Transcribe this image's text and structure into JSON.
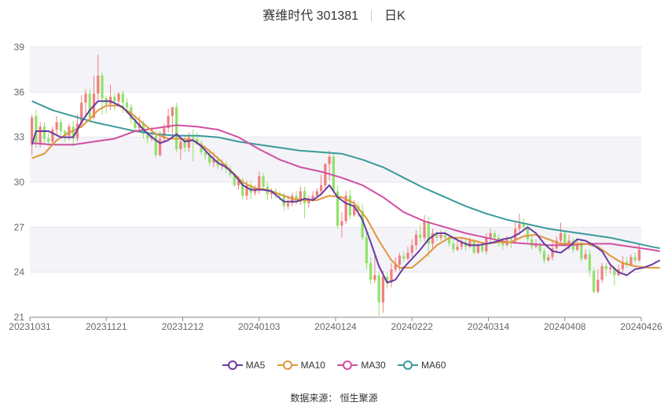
{
  "header": {
    "stock_name": "赛维时代 301381",
    "period": "日K"
  },
  "source_text": "数据来源：  恒生聚源",
  "colors": {
    "up": "#f08080",
    "down": "#91e26a",
    "grid": "#e6e6ee",
    "band": "#f3f3f8"
  },
  "chart_data": {
    "type": "candlestick",
    "title": "赛维时代 301381",
    "ylim": [
      21,
      39
    ],
    "y_ticks": [
      21,
      24,
      27,
      30,
      33,
      36,
      39
    ],
    "x_ticks": [
      "20231031",
      "20231121",
      "20231212",
      "20240103",
      "20240124",
      "20240222",
      "20240314",
      "20240408",
      "20240426"
    ],
    "legend": [
      {
        "name": "MA5",
        "color": "#6a3aa0"
      },
      {
        "name": "MA10",
        "color": "#e0953a"
      },
      {
        "name": "MA30",
        "color": "#d050a0"
      },
      {
        "name": "MA60",
        "color": "#3a9a9a"
      }
    ],
    "candles": [
      [
        32.6,
        34.3,
        31.8,
        34.5
      ],
      [
        34.4,
        32.6,
        32.3,
        34.8
      ],
      [
        32.5,
        33.7,
        32.3,
        34.0
      ],
      [
        33.7,
        32.9,
        32.6,
        34.0
      ],
      [
        32.9,
        32.7,
        32.4,
        33.3
      ],
      [
        32.7,
        33.5,
        32.5,
        33.7
      ],
      [
        33.5,
        34.0,
        33.2,
        34.4
      ],
      [
        34.0,
        33.4,
        33.1,
        34.2
      ],
      [
        33.4,
        33.1,
        32.7,
        33.5
      ],
      [
        33.1,
        33.7,
        32.8,
        33.9
      ],
      [
        33.7,
        32.9,
        32.4,
        34.1
      ],
      [
        32.9,
        33.9,
        32.7,
        34.5
      ],
      [
        33.9,
        35.3,
        33.6,
        35.8
      ],
      [
        35.3,
        35.9,
        34.4,
        36.2
      ],
      [
        35.9,
        34.3,
        34.0,
        36.2
      ],
      [
        34.3,
        35.9,
        34.2,
        37.1
      ],
      [
        35.9,
        37.1,
        35.5,
        38.5
      ],
      [
        37.1,
        35.6,
        34.5,
        37.3
      ],
      [
        35.6,
        35.2,
        34.6,
        35.8
      ],
      [
        35.2,
        35.7,
        34.8,
        36.5
      ],
      [
        35.7,
        35.4,
        34.8,
        35.9
      ],
      [
        35.4,
        35.9,
        35.1,
        36.0
      ],
      [
        35.9,
        35.3,
        34.6,
        36.1
      ],
      [
        35.3,
        35.0,
        34.6,
        35.6
      ],
      [
        35.0,
        34.2,
        33.9,
        35.2
      ],
      [
        34.2,
        33.6,
        33.4,
        34.5
      ],
      [
        33.6,
        33.9,
        33.4,
        34.4
      ],
      [
        33.9,
        33.2,
        32.9,
        34.1
      ],
      [
        33.2,
        32.9,
        32.6,
        33.4
      ],
      [
        32.9,
        33.1,
        32.7,
        33.7
      ],
      [
        33.1,
        31.8,
        31.6,
        33.4
      ],
      [
        31.8,
        32.9,
        31.7,
        33.4
      ],
      [
        32.9,
        33.6,
        32.6,
        33.9
      ],
      [
        33.6,
        34.4,
        33.3,
        34.9
      ],
      [
        34.4,
        35.0,
        33.1,
        35.0
      ],
      [
        35.0,
        32.2,
        32.0,
        35.3
      ],
      [
        32.2,
        32.7,
        31.5,
        32.9
      ],
      [
        32.7,
        32.3,
        32.0,
        33.1
      ],
      [
        32.3,
        33.0,
        32.0,
        33.3
      ],
      [
        33.0,
        32.9,
        31.4,
        33.5
      ],
      [
        32.9,
        32.6,
        32.5,
        33.3
      ],
      [
        32.6,
        32.0,
        31.8,
        32.8
      ],
      [
        32.0,
        31.8,
        31.5,
        32.4
      ],
      [
        31.8,
        31.3,
        31.1,
        32.2
      ],
      [
        31.3,
        31.5,
        31.0,
        32.0
      ],
      [
        31.5,
        31.1,
        30.9,
        31.7
      ],
      [
        31.1,
        31.2,
        30.8,
        31.5
      ],
      [
        31.2,
        30.9,
        30.6,
        31.4
      ],
      [
        30.9,
        30.5,
        30.3,
        31.1
      ],
      [
        30.5,
        29.8,
        29.7,
        30.6
      ],
      [
        29.8,
        30.1,
        29.5,
        30.4
      ],
      [
        30.1,
        29.1,
        28.9,
        30.3
      ],
      [
        29.1,
        29.8,
        28.8,
        30.1
      ],
      [
        29.8,
        29.3,
        28.9,
        30.1
      ],
      [
        29.3,
        29.5,
        29.1,
        29.8
      ],
      [
        29.5,
        30.4,
        29.2,
        30.7
      ],
      [
        30.4,
        29.7,
        29.4,
        30.6
      ],
      [
        29.7,
        29.2,
        28.8,
        30.0
      ],
      [
        29.2,
        29.4,
        28.9,
        29.6
      ],
      [
        29.4,
        29.2,
        28.9,
        29.6
      ],
      [
        29.2,
        29.1,
        28.8,
        29.4
      ],
      [
        29.1,
        28.4,
        28.1,
        29.3
      ],
      [
        28.4,
        28.6,
        28.2,
        29.1
      ],
      [
        28.6,
        29.1,
        28.4,
        29.3
      ],
      [
        29.1,
        28.7,
        28.5,
        29.4
      ],
      [
        28.7,
        29.4,
        28.5,
        29.7
      ],
      [
        29.4,
        28.6,
        27.6,
        29.7
      ],
      [
        28.6,
        28.8,
        28.3,
        29.1
      ],
      [
        28.8,
        29.1,
        28.7,
        29.4
      ],
      [
        29.1,
        29.4,
        29.0,
        29.6
      ],
      [
        29.4,
        29.8,
        29.1,
        30.5
      ],
      [
        29.8,
        31.2,
        29.6,
        31.3
      ],
      [
        31.2,
        31.7,
        30.1,
        32.1
      ],
      [
        31.7,
        29.4,
        29.3,
        31.9
      ],
      [
        29.4,
        27.1,
        26.9,
        29.8
      ],
      [
        27.1,
        27.4,
        26.3,
        28.0
      ],
      [
        27.4,
        29.1,
        27.2,
        29.4
      ],
      [
        29.1,
        27.8,
        27.5,
        29.5
      ],
      [
        27.8,
        28.4,
        27.7,
        28.8
      ],
      [
        28.4,
        28.1,
        27.7,
        28.7
      ],
      [
        28.1,
        26.3,
        26.1,
        28.5
      ],
      [
        26.3,
        24.6,
        24.2,
        26.7
      ],
      [
        24.6,
        23.5,
        23.2,
        25.0
      ],
      [
        23.5,
        23.8,
        23.3,
        25.1
      ],
      [
        23.8,
        22.0,
        21.1,
        24.0
      ],
      [
        22.0,
        23.7,
        21.3,
        24.1
      ],
      [
        23.7,
        23.3,
        22.9,
        24.0
      ],
      [
        23.3,
        24.2,
        23.0,
        24.6
      ],
      [
        24.2,
        24.5,
        24.0,
        25.0
      ],
      [
        24.5,
        25.1,
        24.1,
        25.3
      ],
      [
        25.1,
        24.9,
        24.7,
        25.4
      ],
      [
        24.9,
        25.3,
        24.8,
        25.7
      ],
      [
        25.3,
        25.8,
        25.0,
        26.2
      ],
      [
        25.8,
        26.5,
        25.5,
        26.8
      ],
      [
        26.5,
        26.3,
        26.0,
        27.2
      ],
      [
        26.3,
        27.4,
        26.1,
        27.8
      ],
      [
        27.4,
        25.9,
        25.0,
        27.7
      ],
      [
        25.9,
        26.6,
        25.6,
        26.9
      ],
      [
        26.6,
        26.3,
        26.1,
        26.7
      ],
      [
        26.3,
        26.5,
        26.1,
        26.8
      ],
      [
        26.5,
        26.3,
        26.0,
        26.8
      ],
      [
        26.3,
        25.9,
        25.7,
        26.5
      ],
      [
        25.9,
        25.5,
        25.3,
        26.2
      ],
      [
        25.5,
        25.7,
        25.4,
        26.1
      ],
      [
        25.7,
        26.0,
        25.5,
        26.3
      ],
      [
        26.0,
        25.7,
        25.4,
        26.2
      ],
      [
        25.7,
        26.1,
        25.6,
        26.3
      ],
      [
        26.1,
        25.3,
        25.2,
        26.2
      ],
      [
        25.3,
        25.8,
        25.2,
        26.1
      ],
      [
        25.8,
        25.4,
        25.3,
        26.0
      ],
      [
        25.4,
        26.3,
        25.2,
        26.6
      ],
      [
        26.3,
        26.6,
        25.9,
        26.9
      ],
      [
        26.6,
        26.3,
        26.0,
        26.8
      ],
      [
        26.3,
        26.1,
        25.7,
        26.5
      ],
      [
        26.1,
        25.8,
        25.5,
        26.2
      ],
      [
        25.8,
        26.2,
        25.7,
        26.4
      ],
      [
        26.2,
        26.1,
        25.6,
        26.3
      ],
      [
        26.1,
        26.9,
        25.9,
        27.3
      ],
      [
        26.9,
        27.2,
        26.5,
        27.9
      ],
      [
        27.2,
        27.0,
        26.8,
        27.6
      ],
      [
        27.0,
        26.2,
        26.0,
        27.1
      ],
      [
        26.2,
        25.7,
        25.5,
        26.5
      ],
      [
        25.7,
        25.9,
        25.6,
        26.2
      ],
      [
        25.9,
        25.4,
        25.2,
        26.0
      ],
      [
        25.4,
        24.8,
        24.6,
        25.6
      ],
      [
        24.8,
        25.0,
        24.7,
        25.2
      ],
      [
        25.0,
        25.6,
        24.8,
        26.1
      ],
      [
        25.6,
        26.1,
        25.4,
        26.4
      ],
      [
        26.1,
        26.6,
        25.9,
        27.3
      ],
      [
        26.6,
        25.9,
        25.7,
        26.8
      ],
      [
        25.9,
        26.1,
        25.5,
        26.5
      ],
      [
        26.1,
        25.5,
        25.3,
        26.3
      ],
      [
        25.5,
        25.9,
        25.4,
        26.2
      ],
      [
        25.9,
        24.9,
        24.7,
        26.2
      ],
      [
        24.9,
        25.2,
        24.8,
        25.5
      ],
      [
        25.2,
        24.1,
        23.7,
        25.5
      ],
      [
        24.1,
        22.7,
        22.6,
        24.3
      ],
      [
        22.7,
        23.5,
        22.6,
        24.2
      ],
      [
        23.5,
        24.4,
        23.3,
        24.6
      ],
      [
        24.4,
        24.2,
        23.7,
        24.6
      ],
      [
        24.2,
        24.3,
        23.9,
        24.6
      ],
      [
        24.3,
        23.8,
        23.1,
        24.4
      ],
      [
        23.8,
        24.2,
        23.7,
        24.5
      ],
      [
        24.2,
        24.7,
        24.0,
        25.1
      ],
      [
        24.7,
        24.5,
        24.3,
        25.0
      ],
      [
        24.5,
        25.0,
        24.4,
        25.2
      ],
      [
        25.0,
        24.8,
        24.6,
        25.3
      ],
      [
        24.8,
        25.5,
        24.7,
        25.9
      ]
    ],
    "ma5": [
      [
        0,
        32.5
      ],
      [
        1,
        33.4
      ],
      [
        4,
        33.4
      ],
      [
        7,
        33.0
      ],
      [
        10,
        33.0
      ],
      [
        12,
        34.0
      ],
      [
        14,
        34.8
      ],
      [
        16,
        35.4
      ],
      [
        19,
        35.4
      ],
      [
        22,
        35.0
      ],
      [
        25,
        34.1
      ],
      [
        27,
        33.5
      ],
      [
        29,
        33.0
      ],
      [
        31,
        32.6
      ],
      [
        33,
        32.8
      ],
      [
        35,
        33.2
      ],
      [
        37,
        32.7
      ],
      [
        39,
        32.8
      ],
      [
        41,
        32.4
      ],
      [
        43,
        31.8
      ],
      [
        45,
        31.3
      ],
      [
        47,
        31.0
      ],
      [
        49,
        30.5
      ],
      [
        51,
        29.8
      ],
      [
        53,
        29.5
      ],
      [
        56,
        29.5
      ],
      [
        58,
        29.4
      ],
      [
        61,
        28.7
      ],
      [
        64,
        28.7
      ],
      [
        66,
        28.9
      ],
      [
        68,
        28.8
      ],
      [
        70,
        29.2
      ],
      [
        72,
        29.8
      ],
      [
        74,
        29.0
      ],
      [
        76,
        28.6
      ],
      [
        78,
        28.4
      ],
      [
        80,
        27.5
      ],
      [
        82,
        26.0
      ],
      [
        84,
        24.4
      ],
      [
        86,
        23.3
      ],
      [
        88,
        23.5
      ],
      [
        90,
        24.3
      ],
      [
        92,
        24.9
      ],
      [
        94,
        25.5
      ],
      [
        96,
        26.2
      ],
      [
        98,
        26.6
      ],
      [
        100,
        26.6
      ],
      [
        102,
        26.3
      ],
      [
        104,
        26.0
      ],
      [
        106,
        25.8
      ],
      [
        108,
        25.8
      ],
      [
        110,
        25.9
      ],
      [
        112,
        26.0
      ],
      [
        114,
        26.2
      ],
      [
        116,
        26.3
      ],
      [
        118,
        26.6
      ],
      [
        120,
        27.0
      ],
      [
        122,
        26.6
      ],
      [
        124,
        25.9
      ],
      [
        126,
        25.4
      ],
      [
        128,
        25.3
      ],
      [
        130,
        25.7
      ],
      [
        132,
        26.2
      ],
      [
        134,
        26.1
      ],
      [
        136,
        25.8
      ],
      [
        138,
        25.4
      ],
      [
        140,
        24.5
      ],
      [
        142,
        24.0
      ],
      [
        144,
        23.8
      ],
      [
        146,
        24.2
      ],
      [
        148,
        24.3
      ],
      [
        150,
        24.5
      ],
      [
        152,
        24.8
      ]
    ],
    "ma10": [
      [
        0,
        31.6
      ],
      [
        3,
        31.9
      ],
      [
        6,
        32.8
      ],
      [
        9,
        33.3
      ],
      [
        12,
        33.7
      ],
      [
        14,
        34.2
      ],
      [
        16,
        34.8
      ],
      [
        18,
        35.1
      ],
      [
        21,
        35.1
      ],
      [
        24,
        34.6
      ],
      [
        27,
        33.9
      ],
      [
        30,
        33.2
      ],
      [
        33,
        32.9
      ],
      [
        36,
        32.9
      ],
      [
        39,
        32.8
      ],
      [
        42,
        32.3
      ],
      [
        45,
        31.6
      ],
      [
        48,
        30.8
      ],
      [
        51,
        30.0
      ],
      [
        54,
        29.6
      ],
      [
        57,
        29.5
      ],
      [
        60,
        29.2
      ],
      [
        63,
        28.9
      ],
      [
        66,
        28.8
      ],
      [
        69,
        28.8
      ],
      [
        72,
        29.1
      ],
      [
        75,
        29.0
      ],
      [
        78,
        28.6
      ],
      [
        81,
        27.6
      ],
      [
        84,
        26.1
      ],
      [
        87,
        24.8
      ],
      [
        89,
        24.3
      ],
      [
        92,
        24.3
      ],
      [
        95,
        25.0
      ],
      [
        98,
        25.8
      ],
      [
        101,
        26.3
      ],
      [
        104,
        26.3
      ],
      [
        107,
        26.1
      ],
      [
        110,
        25.9
      ],
      [
        113,
        26.0
      ],
      [
        116,
        26.0
      ],
      [
        119,
        26.4
      ],
      [
        122,
        26.5
      ],
      [
        125,
        26.2
      ],
      [
        128,
        25.9
      ],
      [
        131,
        25.9
      ],
      [
        134,
        25.9
      ],
      [
        137,
        25.7
      ],
      [
        140,
        25.1
      ],
      [
        143,
        24.6
      ],
      [
        146,
        24.4
      ],
      [
        149,
        24.3
      ],
      [
        152,
        24.3
      ]
    ],
    "ma30": [
      [
        0,
        32.6
      ],
      [
        5,
        32.5
      ],
      [
        10,
        32.5
      ],
      [
        15,
        32.7
      ],
      [
        20,
        32.9
      ],
      [
        25,
        33.4
      ],
      [
        30,
        33.6
      ],
      [
        35,
        33.8
      ],
      [
        40,
        33.7
      ],
      [
        45,
        33.5
      ],
      [
        50,
        33.0
      ],
      [
        55,
        32.2
      ],
      [
        60,
        31.5
      ],
      [
        65,
        31.0
      ],
      [
        70,
        30.7
      ],
      [
        75,
        30.3
      ],
      [
        80,
        29.8
      ],
      [
        85,
        29.0
      ],
      [
        90,
        28.0
      ],
      [
        95,
        27.4
      ],
      [
        100,
        27.0
      ],
      [
        105,
        26.6
      ],
      [
        110,
        26.3
      ],
      [
        115,
        26.0
      ],
      [
        120,
        25.9
      ],
      [
        125,
        25.8
      ],
      [
        130,
        25.8
      ],
      [
        135,
        25.9
      ],
      [
        140,
        25.9
      ],
      [
        145,
        25.7
      ],
      [
        150,
        25.5
      ],
      [
        152,
        25.4
      ]
    ],
    "ma60": [
      [
        0,
        35.4
      ],
      [
        5,
        34.8
      ],
      [
        10,
        34.4
      ],
      [
        15,
        34.0
      ],
      [
        20,
        33.7
      ],
      [
        25,
        33.4
      ],
      [
        30,
        33.2
      ],
      [
        35,
        33.1
      ],
      [
        40,
        33.1
      ],
      [
        45,
        33.0
      ],
      [
        50,
        32.7
      ],
      [
        55,
        32.5
      ],
      [
        60,
        32.3
      ],
      [
        65,
        32.1
      ],
      [
        70,
        32.0
      ],
      [
        75,
        31.9
      ],
      [
        80,
        31.5
      ],
      [
        85,
        31.0
      ],
      [
        90,
        30.3
      ],
      [
        95,
        29.6
      ],
      [
        100,
        29.0
      ],
      [
        105,
        28.4
      ],
      [
        110,
        27.9
      ],
      [
        115,
        27.5
      ],
      [
        120,
        27.2
      ],
      [
        125,
        26.9
      ],
      [
        130,
        26.7
      ],
      [
        135,
        26.5
      ],
      [
        140,
        26.3
      ],
      [
        145,
        26.0
      ],
      [
        150,
        25.7
      ],
      [
        152,
        25.6
      ]
    ]
  }
}
